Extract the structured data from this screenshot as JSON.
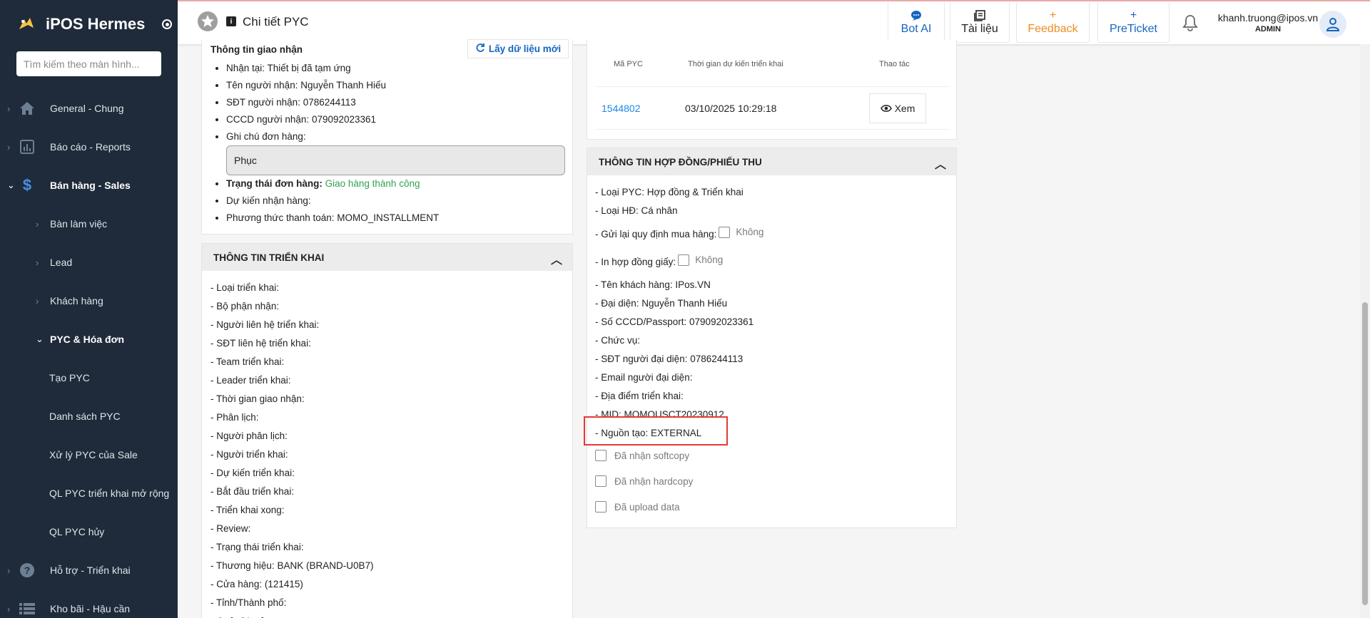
{
  "sidebar": {
    "brand": "iPOS Hermes",
    "search_placeholder": "Tìm kiếm theo màn hình...",
    "items": [
      {
        "label": "General - Chung",
        "icon": "home-icon"
      },
      {
        "label": "Báo cáo - Reports",
        "icon": "bar-chart-icon"
      },
      {
        "label": "Bán hàng - Sales",
        "icon": "dollar-icon"
      }
    ],
    "sales_sub": [
      "Bàn làm việc",
      "Lead",
      "Khách hàng"
    ],
    "pyc_group": "PYC & Hóa đơn",
    "pyc_items": [
      "Tạo PYC",
      "Danh sách PYC",
      "Xử lý PYC của Sale",
      "QL PYC triển khai mở rộng",
      "QL PYC hủy"
    ],
    "bottom_items": [
      {
        "label": "Hỗ trợ - Triển khai",
        "icon": "help-icon"
      },
      {
        "label": "Kho bãi - Hậu cần",
        "icon": "list-icon"
      }
    ]
  },
  "topbar": {
    "title": "Chi tiết PYC",
    "bot_ai": "Bot AI",
    "docs": "Tài liệu",
    "feedback": "Feedback",
    "preticket": "PreTicket",
    "user_email": "khanh.truong@ipos.vn",
    "user_role": "ADMIN"
  },
  "delivery": {
    "title": "Thông tin giao nhận",
    "fetch_button": "Lấy dữ liệu mới",
    "items": [
      "Nhận tại: Thiết bị đã tạm ứng",
      "Tên người nhận: Nguyễn Thanh Hiếu",
      "SĐT người nhận: 0786244113",
      "CCCD người nhận: 079092023361",
      "Ghi chú đơn hàng:"
    ],
    "note": "Phục",
    "status_label": "Trạng thái đơn hàng:",
    "status_value": "Giao hàng thành công",
    "expected": "Dự kiến nhận hàng:",
    "payment": "Phương thức thanh toán: MOMO_INSTALLMENT"
  },
  "deploy": {
    "title": "THÔNG TIN TRIỂN KHAI",
    "lines": [
      "- Loại triển khai:",
      "- Bộ phận nhận:",
      "- Người liên hệ triển khai:",
      "- SĐT liên hệ triển khai:",
      "- Team triển khai:",
      "- Leader triển khai:",
      "- Thời gian giao nhận:",
      "- Phân lịch:",
      "- Người phân lịch:",
      "- Người triển khai:",
      "- Dự kiến triển khai:",
      "- Bắt đầu triển khai:",
      "- Triển khai xong:",
      "- Review:",
      "- Trạng thái triển khai:",
      "- Thương hiệu: BANK (BRAND-U0B7)",
      "- Cửa hàng: (121415)",
      "- Tỉnh/Thành phố:",
      "- Quận/Huyện:"
    ]
  },
  "pyc_table": {
    "headers": [
      "Mã PYC",
      "Thời gian dự kiến triển khai",
      "Thao tác"
    ],
    "rows": [
      {
        "code": "1544802",
        "time": "03/10/2025 10:29:18",
        "action": "Xem"
      }
    ]
  },
  "contract": {
    "title": "THÔNG TIN HỢP ĐỒNG/PHIẾU THU",
    "line_type": "- Loại PYC: Hợp đồng & Triển khai",
    "line_hd": "- Loại HĐ: Cá nhân",
    "resend_label": "- Gửi lại quy định mua hàng:",
    "resend_value": "Không",
    "print_label": "- In hợp đồng giấy:",
    "print_value": "Không",
    "lines": [
      "- Tên khách hàng: IPos.VN",
      "- Đại diện: Nguyễn Thanh Hiếu",
      "- Số CCCD/Passport: 079092023361",
      "- Chức vụ:",
      "- SĐT người đại diện: 0786244113",
      "- Email người đại diện:",
      "- Địa điểm triển khai:",
      "- MID: MOMOUSCT20230912",
      "- Nguồn tạo: EXTERNAL"
    ],
    "checks": [
      "Đã nhận softcopy",
      "Đã nhận hardcopy",
      "Đã upload data"
    ]
  },
  "colors": {
    "sidebar_bg": "#1f2b3a",
    "accent_blue": "#1565c0",
    "feedback_orange": "#ef8c1e",
    "success_green": "#2ea44f",
    "highlight_red": "#e53935"
  }
}
